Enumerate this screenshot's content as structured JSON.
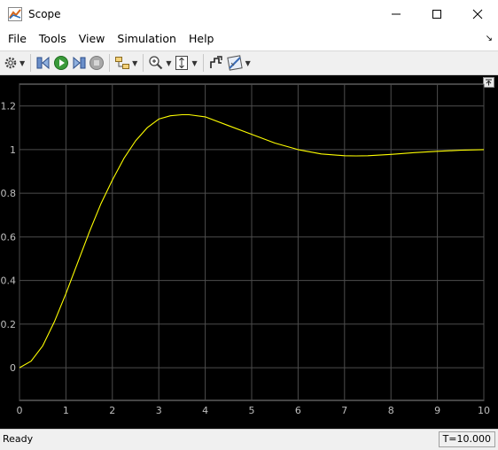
{
  "window": {
    "title": "Scope"
  },
  "menu": [
    "File",
    "Tools",
    "View",
    "Simulation",
    "Help"
  ],
  "toolbar": {
    "buttons": [
      "settings-icon",
      "step-back-icon",
      "run-icon",
      "step-forward-icon",
      "stop-icon",
      "highlight-block-icon",
      "zoom-in-icon",
      "fit-scale-icon",
      "restore-icon",
      "cursor-measure-icon"
    ]
  },
  "status": {
    "left": "Ready",
    "right": "T=10.000"
  },
  "colors": {
    "plot_bg": "#000000",
    "trace": "#ffff00",
    "grid": "#4d4d4d",
    "tick": "#bfbfbf"
  },
  "chart_data": {
    "type": "line",
    "title": "",
    "xlabel": "",
    "ylabel": "",
    "xlim": [
      0,
      10
    ],
    "ylim": [
      -0.15,
      1.3
    ],
    "xticks": [
      0,
      1,
      2,
      3,
      4,
      5,
      6,
      7,
      8,
      9,
      10
    ],
    "yticks": [
      0,
      0.2,
      0.4,
      0.6,
      0.8,
      1,
      1.2
    ],
    "xtick_labels": [
      "0",
      "1",
      "2",
      "3",
      "4",
      "5",
      "6",
      "7",
      "8",
      "9",
      "10"
    ],
    "ytick_labels": [
      "0",
      "0.2",
      "0.4",
      "0.6",
      "0.8",
      "1",
      "1.2"
    ],
    "grid": true,
    "series": [
      {
        "x": [
          0,
          0.25,
          0.5,
          0.75,
          1,
          1.25,
          1.5,
          1.75,
          2,
          2.25,
          2.5,
          2.75,
          3,
          3.25,
          3.5,
          3.65,
          4,
          4.5,
          5,
          5.5,
          6,
          6.5,
          7,
          7.25,
          7.5,
          8,
          8.5,
          9,
          9.5,
          10
        ],
        "y": [
          0,
          0.03,
          0.1,
          0.21,
          0.34,
          0.48,
          0.62,
          0.75,
          0.86,
          0.96,
          1.04,
          1.1,
          1.14,
          1.155,
          1.16,
          1.16,
          1.15,
          1.11,
          1.07,
          1.03,
          1.0,
          0.98,
          0.972,
          0.971,
          0.972,
          0.978,
          0.986,
          0.992,
          0.997,
          1.0
        ]
      }
    ]
  }
}
